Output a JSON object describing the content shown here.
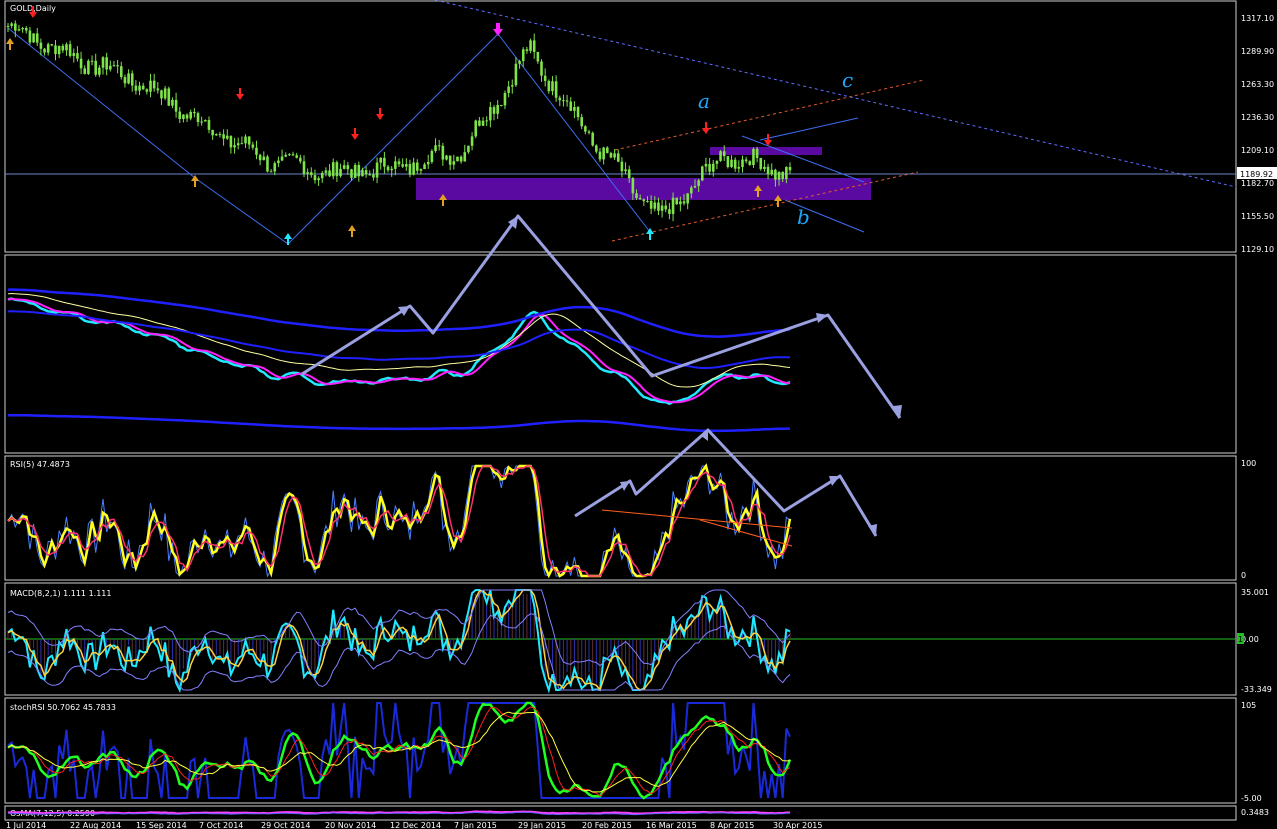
{
  "symbol_title": "GOLD,Daily",
  "price_axis": [
    "1317.10",
    "1289.90",
    "1263.30",
    "1236.30",
    "1209.10",
    "1182.70",
    "1155.50",
    "1129.10"
  ],
  "current_price": "1189.92",
  "wave_labels": {
    "a": "a",
    "b": "b",
    "c": "c"
  },
  "panels": {
    "rsi": {
      "title": "RSI(5) 47.4873",
      "scale": [
        "100",
        "0"
      ]
    },
    "macd": {
      "title": "MACD(8,2,1) 1.111 1.111",
      "scale": [
        "35.001",
        "0.00",
        "-33.349"
      ],
      "current_label": "1"
    },
    "stochrsi": {
      "title": "stochRSI 50.7062 45.7833",
      "scale": [
        "105",
        "-5.00"
      ]
    },
    "osma": {
      "title": "OsMA(7,12,5) 0.2590",
      "scale": [
        "0.3483"
      ]
    }
  },
  "date_axis": [
    "1 Jul 2014",
    "22 Aug 2014",
    "15 Sep 2014",
    "7 Oct 2014",
    "29 Oct 2014",
    "20 Nov 2014",
    "12 Dec 2014",
    "7 Jan 2015",
    "29 Jan 2015",
    "20 Feb 2015",
    "16 Mar 2015",
    "8 Apr 2015",
    "30 Apr 2015"
  ],
  "colors": {
    "background": "#000000",
    "candles": "#7fe34a",
    "zone": "#5a0aa0",
    "trend_blue": "#3e6cf0",
    "arrow_up": "#e0a020",
    "arrow_down": "#ff2020",
    "rsi_line": "#ffff20",
    "cyan": "#20e8ff",
    "magenta": "#ff20ff",
    "arrow_path": "#9aa0e0"
  },
  "chart_data": {
    "type": "line",
    "title": "GOLD,Daily",
    "xlabel": "",
    "ylabel": "",
    "ylim": [
      1129.1,
      1317.1
    ],
    "x": [
      "1 Jul 2014",
      "22 Aug 2014",
      "15 Sep 2014",
      "7 Oct 2014",
      "29 Oct 2014",
      "20 Nov 2014",
      "12 Dec 2014",
      "7 Jan 2015",
      "29 Jan 2015",
      "20 Feb 2015",
      "16 Mar 2015",
      "8 Apr 2015",
      "30 Apr 2015"
    ],
    "series": [
      {
        "values": [
          1310,
          1285,
          1265,
          1230,
          1200,
          1190,
          1195,
          1210,
          1290,
          1215,
          1152,
          1205,
          1190
        ]
      }
    ],
    "current_price": 1189.92,
    "grid": false
  }
}
